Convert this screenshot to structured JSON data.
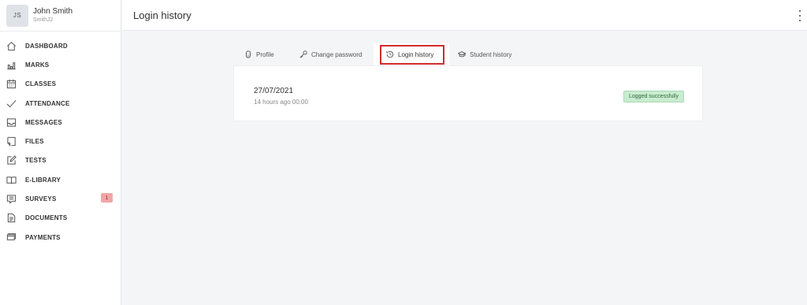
{
  "user": {
    "initials": "JS",
    "name": "John Smith",
    "login": "SmithJ2"
  },
  "sidebar": {
    "items": [
      {
        "label": "DASHBOARD",
        "icon": "home-icon"
      },
      {
        "label": "MARKS",
        "icon": "bar-chart-icon"
      },
      {
        "label": "CLASSES",
        "icon": "calendar-icon"
      },
      {
        "label": "ATTENDANCE",
        "icon": "checkmark-icon"
      },
      {
        "label": "MESSAGES",
        "icon": "inbox-icon"
      },
      {
        "label": "FILES",
        "icon": "file-icon"
      },
      {
        "label": "TESTS",
        "icon": "edit-icon"
      },
      {
        "label": "E-LIBRARY",
        "icon": "book-icon"
      },
      {
        "label": "SURVEYS",
        "icon": "survey-icon",
        "badge": "1"
      },
      {
        "label": "DOCUMENTS",
        "icon": "document-icon"
      },
      {
        "label": "PAYMENTS",
        "icon": "payments-icon"
      }
    ]
  },
  "header": {
    "title": "Login history"
  },
  "tabs": {
    "profile": "Profile",
    "change_password": "Change password",
    "login_history": "Login history",
    "student_history": "Student history",
    "active": "login_history"
  },
  "entries": [
    {
      "date": "27/07/2021",
      "time": "14 hours ago 00:00",
      "status": "Logged successfully"
    }
  ],
  "colors": {
    "highlight": "#d12c2c",
    "status_bg": "#c9ecd0",
    "badge_bg": "#f0a6a6"
  }
}
